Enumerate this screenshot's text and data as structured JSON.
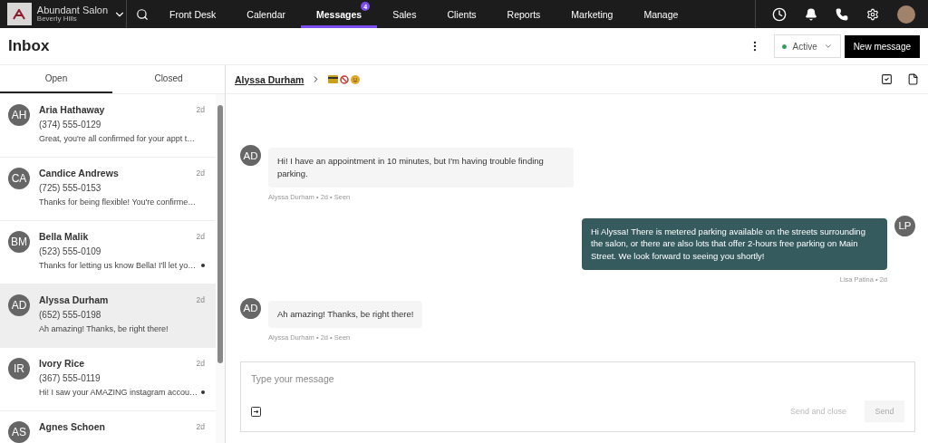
{
  "business": {
    "name": "Abundant Salon",
    "location": "Beverly Hills"
  },
  "nav": [
    {
      "label": "Front Desk",
      "selected": false
    },
    {
      "label": "Calendar",
      "selected": false
    },
    {
      "label": "Messages",
      "selected": true,
      "badge": "4"
    },
    {
      "label": "Sales",
      "selected": false
    },
    {
      "label": "Clients",
      "selected": false
    },
    {
      "label": "Reports",
      "selected": false
    },
    {
      "label": "Marketing",
      "selected": false
    },
    {
      "label": "Manage",
      "selected": false
    }
  ],
  "page_title": "Inbox",
  "status": {
    "label": "Active",
    "color": "#2e9e5b"
  },
  "new_message_button": "New message",
  "tabs": [
    {
      "label": "Open",
      "selected": true
    },
    {
      "label": "Closed",
      "selected": false
    }
  ],
  "conversations": [
    {
      "initials": "AH",
      "name": "Aria Hathaway",
      "time": "2d",
      "phone": "(374) 555-0129",
      "preview": "Great, you're all confirmed for your appt t…",
      "selected": false,
      "unread": false
    },
    {
      "initials": "CA",
      "name": "Candice Andrews",
      "time": "2d",
      "phone": "(725) 555-0153",
      "preview": "Thanks for being flexible! You're confirme…",
      "selected": false,
      "unread": false
    },
    {
      "initials": "BM",
      "name": "Bella Malik",
      "time": "2d",
      "phone": "(523) 555-0109",
      "preview": "Thanks for letting us know Bella! I'll let yo…",
      "selected": false,
      "unread": true
    },
    {
      "initials": "AD",
      "name": "Alyssa Durham",
      "time": "2d",
      "phone": "(652) 555-0198",
      "preview": "Ah amazing! Thanks, be right there!",
      "selected": true,
      "unread": false
    },
    {
      "initials": "IR",
      "name": "Ivory Rice",
      "time": "2d",
      "phone": "(367) 555-0119",
      "preview": "Hi! I saw your AMAZING instagram accou…",
      "selected": false,
      "unread": true
    },
    {
      "initials": "AS",
      "name": "Agnes Schoen",
      "time": "2d",
      "selected": false
    }
  ],
  "chat": {
    "contact": "Alyssa Durham",
    "messages": [
      {
        "kind": "incoming",
        "initials": "AD",
        "text": "Hi! I have an appointment in 10 minutes, but I'm having trouble finding parking.",
        "meta": "Alyssa Durham • 2d • Seen"
      },
      {
        "kind": "outgoing",
        "initials": "LP",
        "text": "Hi Alyssa! There is metered parking available on the streets surrounding the salon, or there are also lots that offer 2-hours free parking on Main Street. We look forward to seeing you shortly!",
        "meta": "Lisa Patina • 2d"
      },
      {
        "kind": "incoming",
        "initials": "AD",
        "text": "Ah amazing! Thanks, be right there!",
        "meta": "Alyssa Durham • 2d • Seen"
      }
    ]
  },
  "composer": {
    "placeholder": "Type your message",
    "send_and_close": "Send and close",
    "send": "Send"
  }
}
